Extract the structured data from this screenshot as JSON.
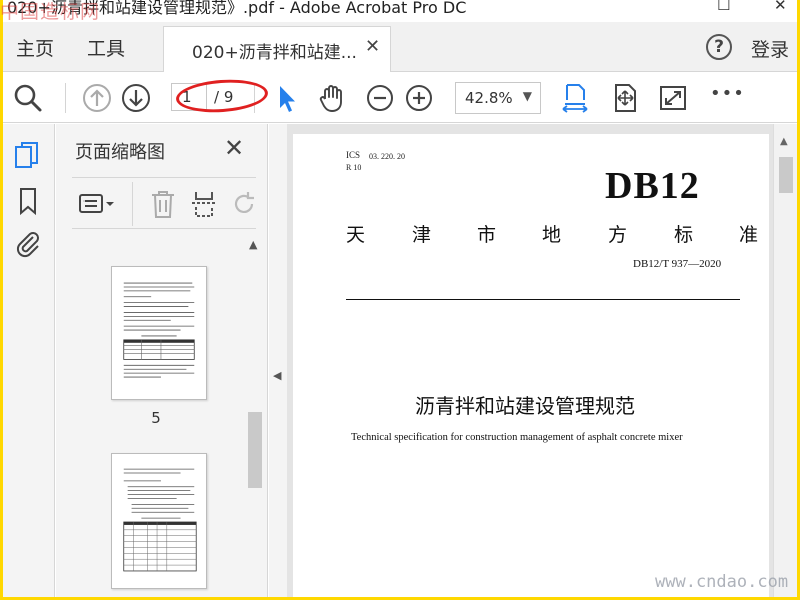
{
  "window": {
    "title": "020+沥青拌和站建设管理规范》.pdf - Adobe Acrobat Pro DC",
    "minimize_label": "–",
    "maximize_label": "☐",
    "close_label": "✕"
  },
  "menu": {
    "home": "主页",
    "tools": "工具",
    "tab_label": "020+沥青拌和站建...",
    "tab_close": "✕",
    "help_label": "?",
    "login": "登录"
  },
  "toolbar": {
    "current_page": "1",
    "total_pages": "/ 9",
    "zoom": "42.8%",
    "zoom_arrow": "▼",
    "more_label": "•••",
    "icons": [
      "search-icon",
      "prev-page-icon",
      "next-page-icon",
      "select-cursor-icon",
      "hand-icon",
      "zoom-out-icon",
      "zoom-in-icon",
      "fit-width-icon",
      "fit-page-icon",
      "fullscreen-icon",
      "more-icon"
    ]
  },
  "thumbnails_panel": {
    "title": "页面缩略图",
    "close_label": "✕",
    "pages": [
      {
        "number": "5"
      },
      {
        "number": ""
      }
    ]
  },
  "document": {
    "ics_label": "ICS",
    "ics_code": "03. 220. 20",
    "r_code": "R 10",
    "standard_code": "DB12",
    "authority": [
      "天",
      "津",
      "市",
      "地",
      "方",
      "标",
      "准"
    ],
    "doc_number": "DB12/T 937—2020",
    "title_cn": "沥青拌和站建设管理规范",
    "title_en": "Technical specification for construction management of asphalt concrete mixer"
  },
  "watermarks": {
    "top": "中国造标网",
    "bottom": "www.cndao.com"
  },
  "colors": {
    "accent_blue": "#2680eb",
    "annotation_red": "#e02020",
    "frame_yellow": "#ffd800"
  }
}
